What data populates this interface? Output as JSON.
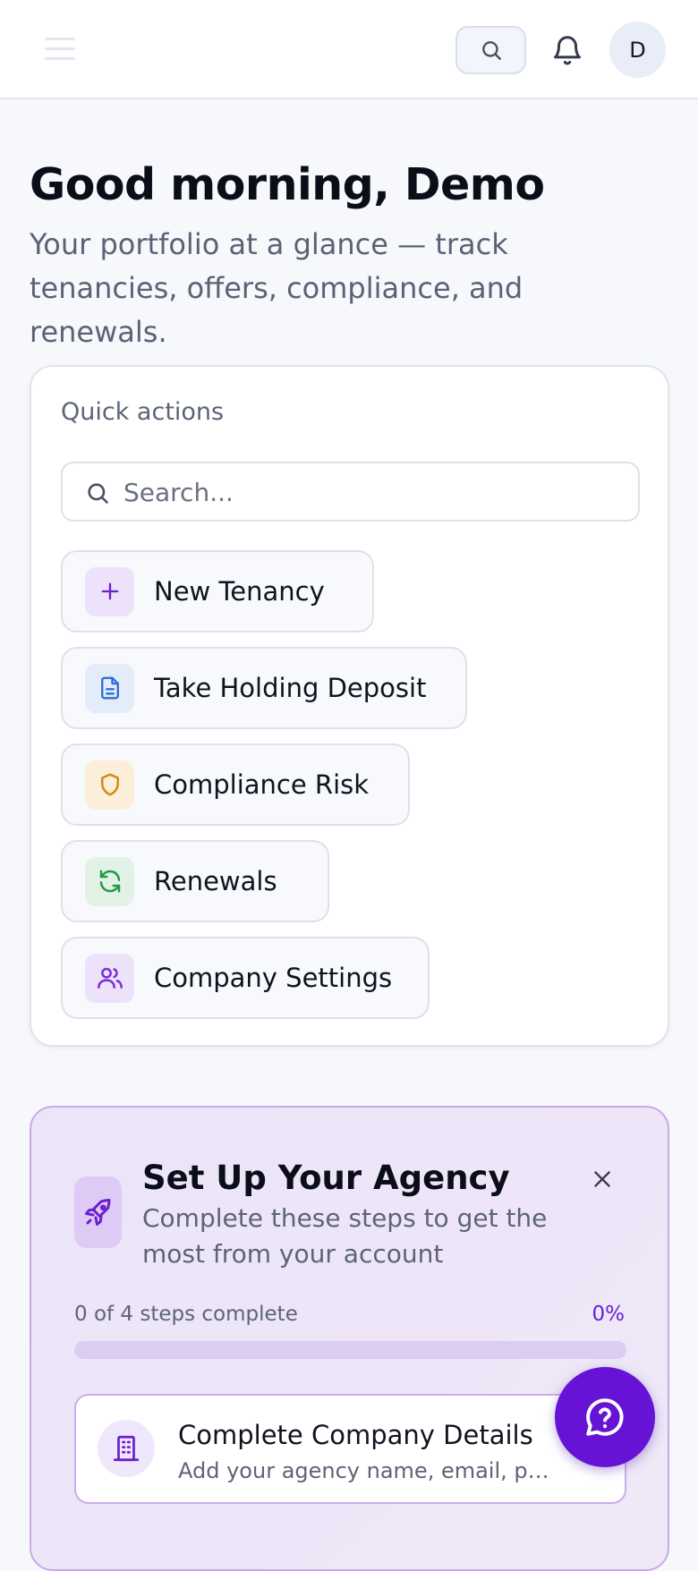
{
  "header": {
    "avatar_initial": "D"
  },
  "greeting": "Good morning, Demo",
  "subtitle": "Your portfolio at a glance — track tenancies, offers, compliance, and renewals.",
  "quick_actions": {
    "title": "Quick actions",
    "search_placeholder": "Search...",
    "items": [
      {
        "label": "New Tenancy",
        "icon": "plus-icon",
        "color": "#6a1fd1",
        "bg": "#ece2fa"
      },
      {
        "label": "Take Holding Deposit",
        "icon": "document-icon",
        "color": "#2f6fd6",
        "bg": "#e3ecf8"
      },
      {
        "label": "Compliance Risk",
        "icon": "shield-icon",
        "color": "#d28a12",
        "bg": "#fbefdc"
      },
      {
        "label": "Renewals",
        "icon": "refresh-icon",
        "color": "#23994a",
        "bg": "#e2f2e6"
      },
      {
        "label": "Company Settings",
        "icon": "users-icon",
        "color": "#7a2fd6",
        "bg": "#ece2fa"
      }
    ]
  },
  "setup": {
    "title": "Set Up Your Agency",
    "description": "Complete these steps to get the most from your account",
    "steps_text": "0 of 4 steps complete",
    "percent_text": "0%",
    "progress": 0,
    "step": {
      "title": "Complete Company Details",
      "subtitle": "Add your agency name, email, phone and address"
    }
  },
  "colors": {
    "accent": "#6613d6"
  }
}
